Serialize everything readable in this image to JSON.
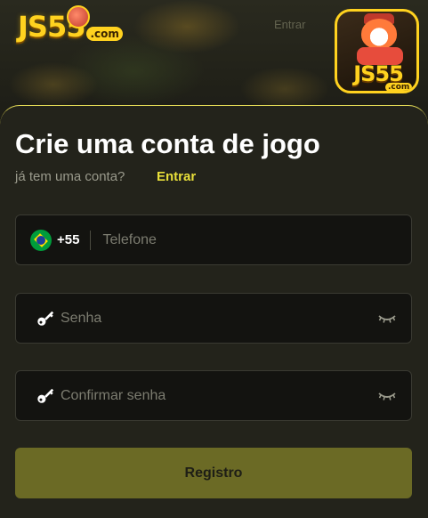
{
  "header": {
    "logo_text": "JS55",
    "logo_domain": ".com",
    "faded_text": "Entrar",
    "app_icon_text": "JS55",
    "app_icon_domain": ".com"
  },
  "form": {
    "title": "Crie uma conta de jogo",
    "subtitle": "já tem uma conta?",
    "login_link": "Entrar",
    "phone": {
      "country_code": "+55",
      "flag_icon": "brazil-flag-icon",
      "placeholder": "Telefone",
      "value": ""
    },
    "password": {
      "icon": "key-icon",
      "placeholder": "Senha",
      "value": "",
      "toggle_icon": "eye-closed-icon"
    },
    "confirm_password": {
      "icon": "key-icon",
      "placeholder": "Confirmar senha",
      "value": "",
      "toggle_icon": "eye-closed-icon"
    },
    "submit_label": "Registro"
  },
  "colors": {
    "accent": "#e8df3a",
    "button": "#6b6a25",
    "sheet": "#23231b",
    "field": "#131310"
  }
}
